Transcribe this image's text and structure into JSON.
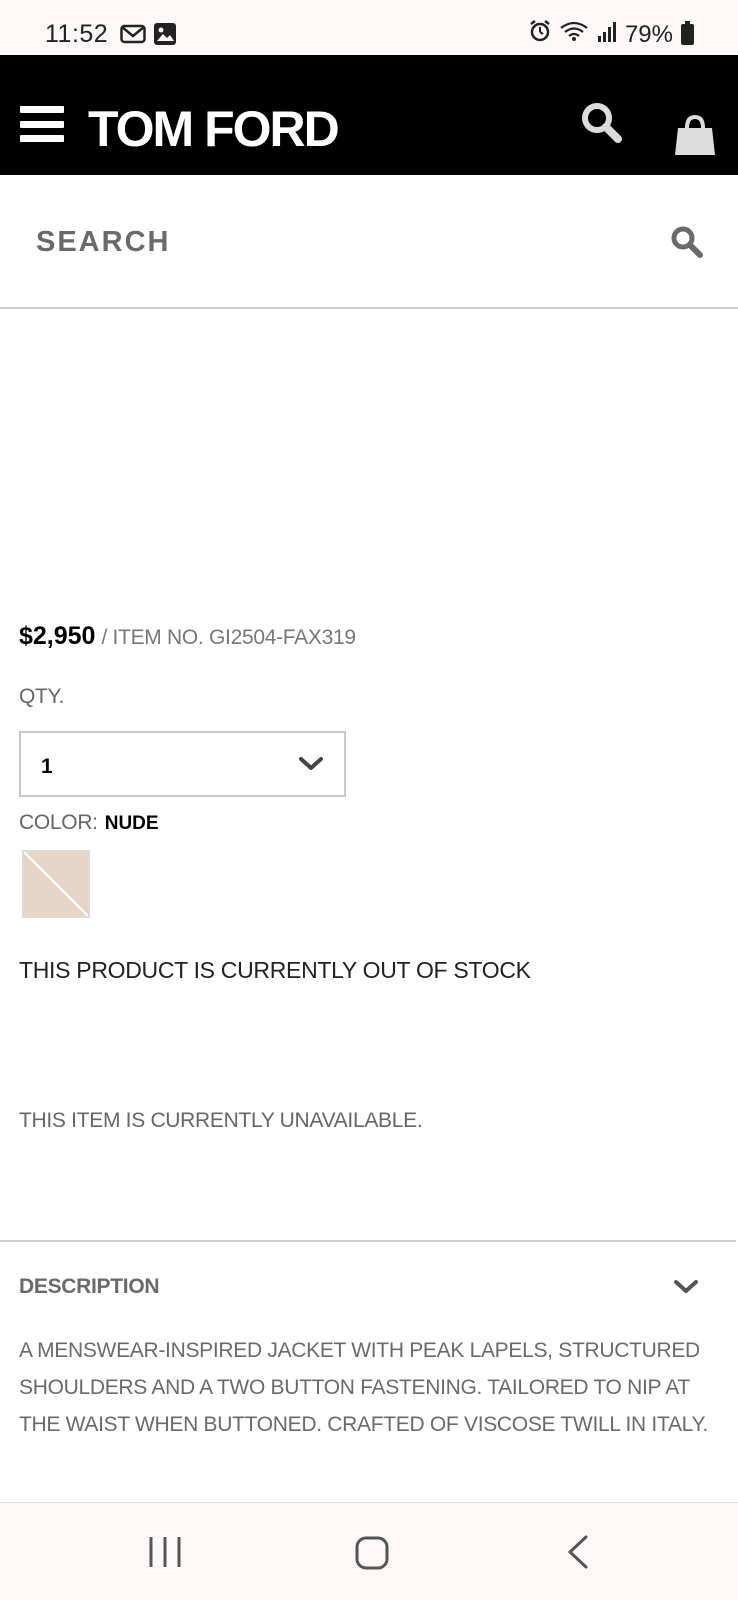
{
  "status_bar": {
    "time": "11:52",
    "battery": "79%",
    "icons": [
      "gmail-icon",
      "image-icon",
      "alarm-icon",
      "wifi-icon",
      "signal-icon",
      "battery-icon"
    ]
  },
  "header": {
    "logo": "TOM FORD",
    "icons": [
      "menu-icon",
      "search-icon",
      "shopping-bag-icon"
    ],
    "background": "#000000"
  },
  "search": {
    "placeholder": "SEARCH"
  },
  "product": {
    "price": "$2,950",
    "item_no": "/ ITEM NO. GI2504-FAX319",
    "qty_label": "QTY.",
    "qty_value": "1",
    "color_label": "COLOR:",
    "color_value": "NUDE",
    "swatch_color": "#e8d8cc",
    "stock_message": "THIS PRODUCT IS CURRENTLY OUT OF STOCK",
    "availability_message": "THIS ITEM IS CURRENTLY UNAVAILABLE."
  },
  "description": {
    "title": "DESCRIPTION",
    "body": "A MENSWEAR-INSPIRED JACKET WITH PEAK LAPELS, STRUCTURED SHOULDERS AND A TWO BUTTON FASTENING. TAILORED TO NIP AT THE WAIST WHEN BUTTONED. CRAFTED OF VISCOSE TWILL IN ITALY."
  },
  "nav_bar": {
    "buttons": [
      "recents-icon",
      "home-icon",
      "back-icon"
    ]
  }
}
